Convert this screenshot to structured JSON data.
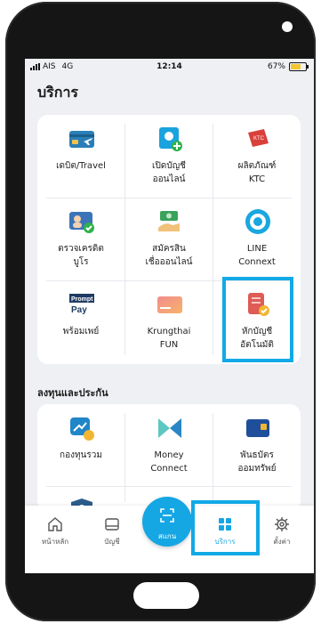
{
  "status_bar": {
    "carrier": "AIS",
    "network": "4G",
    "time": "12:14",
    "battery": "67%",
    "battery_level": 0.67
  },
  "page_title": "บริการ",
  "services": [
    {
      "label": "เดบิต/Travel",
      "icon": "debit-travel-card-icon"
    },
    {
      "label": "เปิดบัญชี\nออนไลน์",
      "icon": "open-account-icon"
    },
    {
      "label": "ผลิตภัณฑ์\nKTC",
      "icon": "ktc-icon"
    },
    {
      "label": "ตรวจเครดิต\nบูโร",
      "icon": "credit-bureau-icon"
    },
    {
      "label": "สมัครสิน\nเชื่อออนไลน์",
      "icon": "loan-money-icon"
    },
    {
      "label": "LINE\nConnext",
      "icon": "line-connext-icon"
    },
    {
      "label": "พร้อมเพย์",
      "icon": "promptpay-icon"
    },
    {
      "label": "Krungthai\nFUN",
      "icon": "krungthai-fun-card-icon"
    },
    {
      "label": "หักบัญชี\nอัตโนมัติ",
      "icon": "auto-debit-icon"
    }
  ],
  "invest_section_title": "ลงทุนและประกัน",
  "invest_items": [
    {
      "label": "กองทุนรวม",
      "icon": "mutual-fund-icon"
    },
    {
      "label": "Money\nConnect",
      "icon": "money-connect-icon"
    },
    {
      "label": "พันธบัตร\nออมทรัพย์",
      "icon": "savings-bond-icon"
    }
  ],
  "nav": {
    "home": "หน้าหลัก",
    "accounts": "บัญชี",
    "scan": "สแกน",
    "services": "บริการ",
    "settings": "ตั้งค่า"
  },
  "colors": {
    "accent": "#12a9e6",
    "scan_button": "#15a6e4",
    "background": "#eef0f3"
  }
}
